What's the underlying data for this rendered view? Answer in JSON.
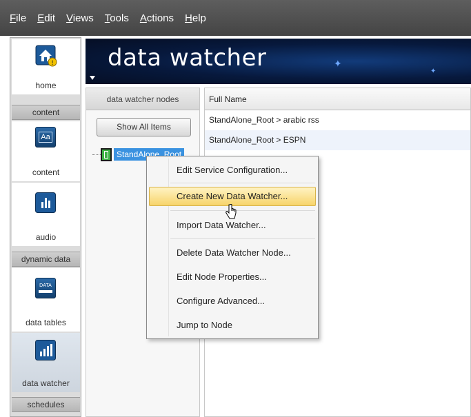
{
  "menubar": {
    "items": [
      {
        "accel": "F",
        "rest": "ile"
      },
      {
        "accel": "E",
        "rest": "dit"
      },
      {
        "accel": "V",
        "rest": "iews"
      },
      {
        "accel": "T",
        "rest": "ools"
      },
      {
        "accel": "A",
        "rest": "ctions"
      },
      {
        "accel": "H",
        "rest": "elp"
      }
    ]
  },
  "leftnav": {
    "home": "home",
    "content_section": "content",
    "content": "content",
    "content_icon_text": "Aa",
    "audio": "audio",
    "dynamic_section": "dynamic data",
    "data_tables": "data tables",
    "data_tables_icon_text": "DATA",
    "data_watcher": "data watcher",
    "schedules_section": "schedules"
  },
  "banner": {
    "title": "data watcher"
  },
  "nodes_panel": {
    "header": "data watcher nodes",
    "show_all": "Show All Items",
    "tree_node": "StandAlone_Root"
  },
  "grid": {
    "column_header": "Full Name",
    "rows": [
      "StandAlone_Root > arabic rss",
      "StandAlone_Root > ESPN"
    ]
  },
  "context_menu": {
    "items": [
      "Edit Service Configuration...",
      "Create New Data Watcher...",
      "Import Data Watcher...",
      "Delete Data Watcher Node...",
      "Edit Node Properties...",
      "Configure Advanced...",
      "Jump to Node"
    ],
    "hovered_index": 1
  },
  "colors": {
    "menubar": "#4f4f4f",
    "selection": "#3a92e0",
    "menu_highlight": "#f7d46a",
    "banner": "#07193d"
  }
}
